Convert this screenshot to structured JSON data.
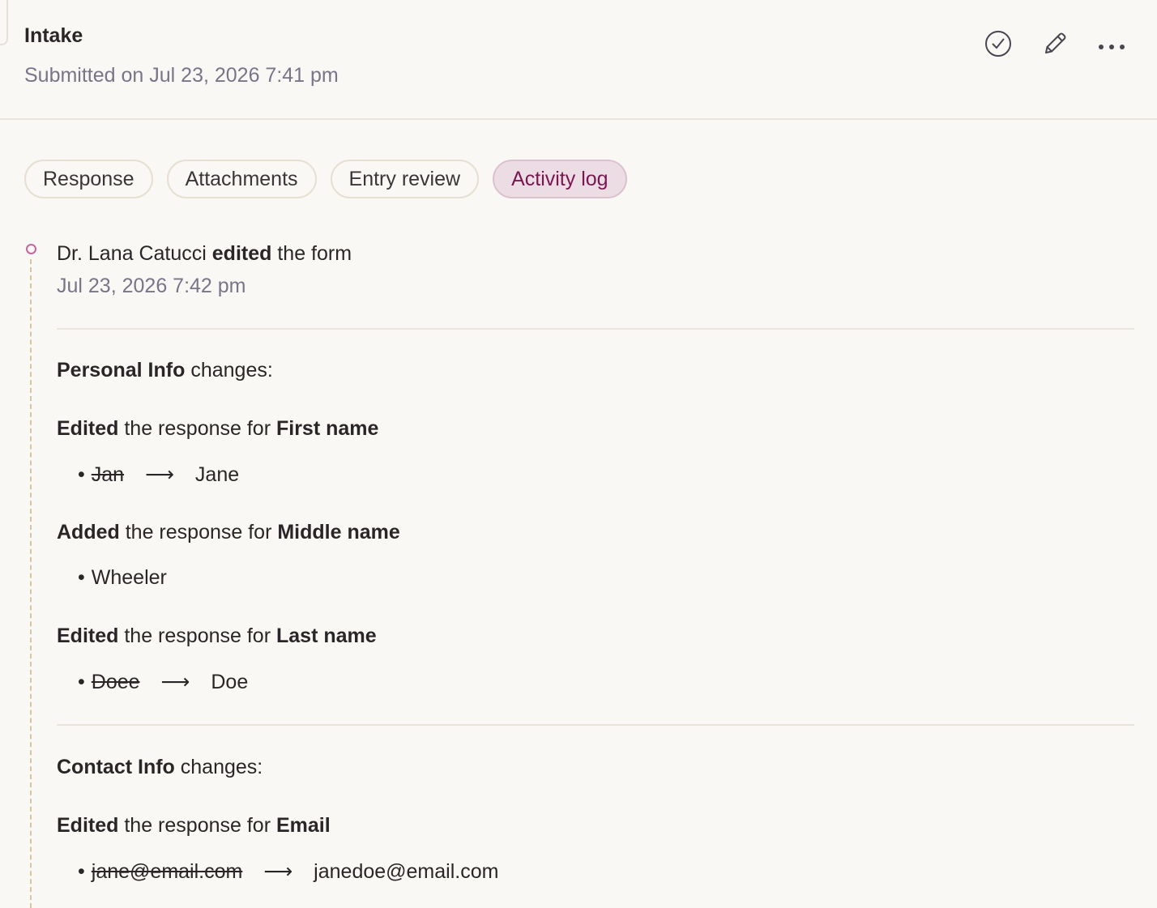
{
  "header": {
    "title": "Intake",
    "subtitle": "Submitted on Jul 23, 2026 7:41 pm"
  },
  "tabs": [
    {
      "label": "Response",
      "active": false
    },
    {
      "label": "Attachments",
      "active": false
    },
    {
      "label": "Entry review",
      "active": false
    },
    {
      "label": "Activity log",
      "active": true
    }
  ],
  "activity": {
    "actor": "Dr. Lana Catucci",
    "action": "edited",
    "object": "the form",
    "time": "Jul 23, 2026 7:42 pm",
    "sections": [
      {
        "name": "Personal Info",
        "suffix": "changes:",
        "changes": [
          {
            "verb": "Edited",
            "phrase": "the response for",
            "field": "First name",
            "old": "Jan",
            "arrow": "⟶",
            "new": "Jane"
          },
          {
            "verb": "Added",
            "phrase": "the response for",
            "field": "Middle name",
            "value": "Wheeler"
          },
          {
            "verb": "Edited",
            "phrase": "the response for",
            "field": "Last name",
            "old": "Doee",
            "arrow": "⟶",
            "new": "Doe"
          }
        ]
      },
      {
        "name": "Contact Info",
        "suffix": "changes:",
        "changes": [
          {
            "verb": "Edited",
            "phrase": "the response for",
            "field": "Email",
            "old": "jane@email.com",
            "arrow": "⟶",
            "new": "janedoe@email.com"
          }
        ]
      }
    ]
  },
  "icons": {
    "approve": "check-circle-icon",
    "edit": "pencil-icon",
    "more": "more-horizontal-icon"
  },
  "colors": {
    "accent": "#7a1652",
    "accent_bg": "#ecdde4",
    "muted_text": "#7a7488",
    "timeline": "#d9c3a5"
  },
  "bullet": "•"
}
